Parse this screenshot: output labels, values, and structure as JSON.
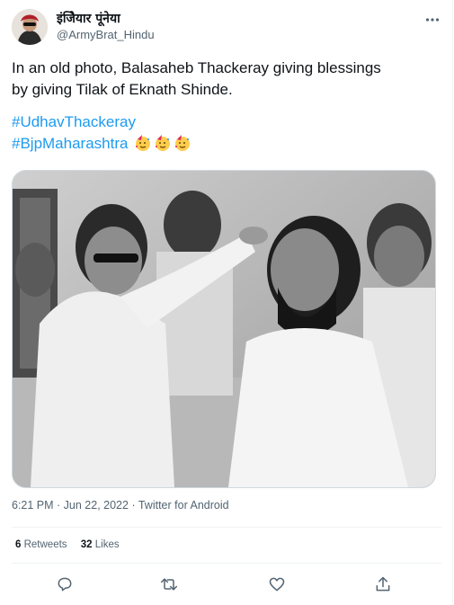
{
  "author": {
    "display_name": "इंजेियार पूंनेया",
    "handle": "@ArmyBrat_Hindu"
  },
  "tweet": {
    "text_line1": "In an old photo, Balasaheb Thackeray giving blessings",
    "text_line2": "by giving Tilak of Eknath Shinde.",
    "hashtag1": "#UdhavThackeray",
    "hashtag2": "#BjpMaharashtra"
  },
  "emojis": [
    "partying-face-icon",
    "partying-face-icon",
    "partying-face-icon"
  ],
  "meta": {
    "time": "6:21 PM",
    "separator1": " · ",
    "date": "Jun 22, 2022",
    "separator2": " · ",
    "source": "Twitter for Android"
  },
  "stats": {
    "retweets_count": "6",
    "retweets_label": " Retweets",
    "likes_count": "32",
    "likes_label": " Likes"
  },
  "actions": [
    "reply-icon",
    "retweet-icon",
    "like-icon",
    "share-icon"
  ],
  "colors": {
    "accent": "#1d9bf0",
    "text": "#0f1419",
    "secondary": "#536471",
    "divider": "#eff3f4"
  }
}
